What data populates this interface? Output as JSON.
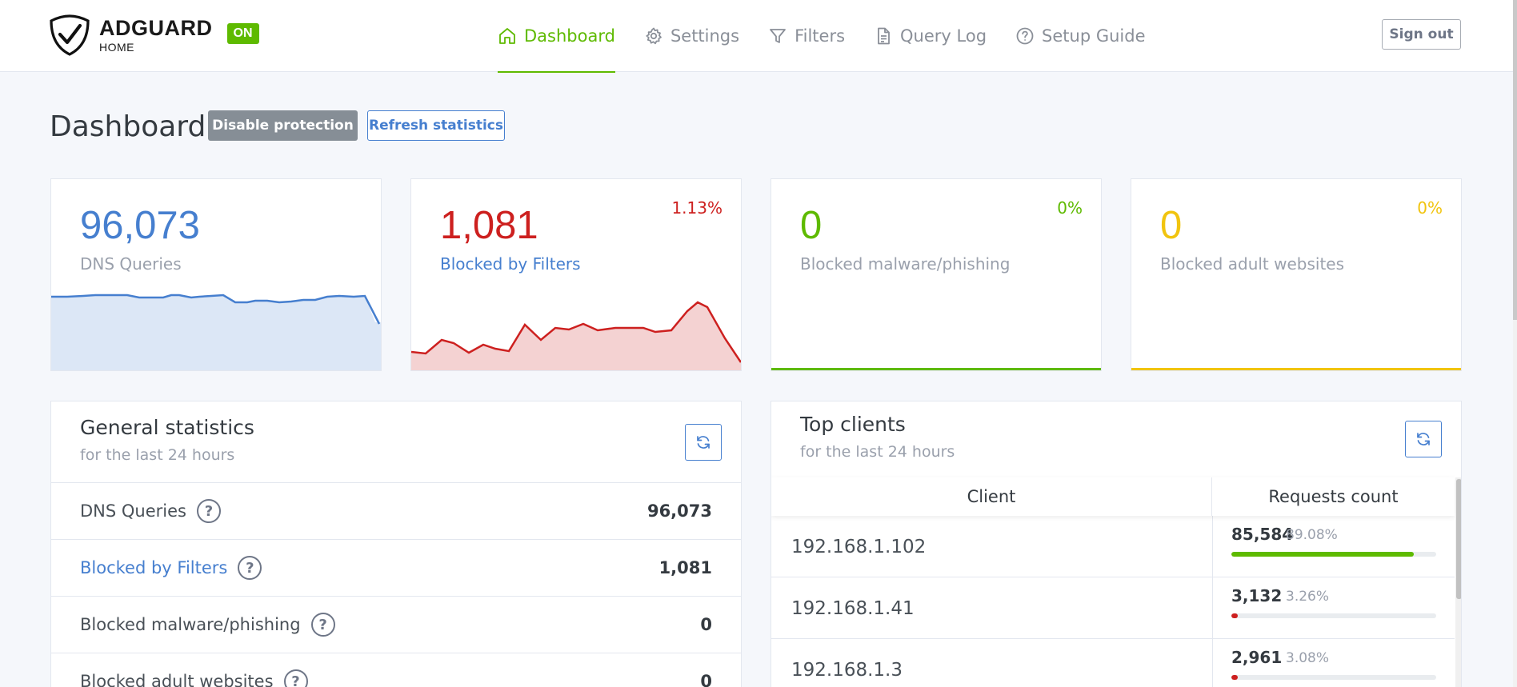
{
  "header": {
    "brand_name": "ADGUARD",
    "brand_sub": "HOME",
    "status_badge": "ON",
    "nav": [
      {
        "label": "Dashboard",
        "icon": "home-icon",
        "active": true
      },
      {
        "label": "Settings",
        "icon": "gear-icon",
        "active": false
      },
      {
        "label": "Filters",
        "icon": "filter-icon",
        "active": false
      },
      {
        "label": "Query Log",
        "icon": "document-icon",
        "active": false
      },
      {
        "label": "Setup Guide",
        "icon": "help-circle-icon",
        "active": false
      }
    ],
    "sign_out": "Sign out"
  },
  "page": {
    "title": "Dashboard",
    "disable_protection": "Disable protection",
    "refresh_statistics": "Refresh statistics"
  },
  "cards": [
    {
      "value": "96,073",
      "label": "DNS Queries",
      "percent": "",
      "color": "#467fcf"
    },
    {
      "value": "1,081",
      "label": "Blocked by Filters",
      "percent": "1.13%",
      "color": "#cd201f"
    },
    {
      "value": "0",
      "label": "Blocked malware/phishing",
      "percent": "0%",
      "color": "#5eba00"
    },
    {
      "value": "0",
      "label": "Blocked adult websites",
      "percent": "0%",
      "color": "#f1c40f"
    }
  ],
  "general_statistics": {
    "title": "General statistics",
    "subtitle": "for the last 24 hours",
    "rows": [
      {
        "label": "DNS Queries",
        "value": "96,073"
      },
      {
        "label": "Blocked by Filters",
        "value": "1,081"
      },
      {
        "label": "Blocked malware/phishing",
        "value": "0"
      },
      {
        "label": "Blocked adult websites",
        "value": "0"
      }
    ]
  },
  "top_clients": {
    "title": "Top clients",
    "subtitle": "for the last 24 hours",
    "columns": [
      "Client",
      "Requests count"
    ],
    "rows": [
      {
        "ip": "192.168.1.102",
        "count": "85,584",
        "percent": "89.08%",
        "fraction": 0.8908,
        "color": "#5eba00"
      },
      {
        "ip": "192.168.1.41",
        "count": "3,132",
        "percent": "3.26%",
        "fraction": 0.0326,
        "color": "#cd201f"
      },
      {
        "ip": "192.168.1.3",
        "count": "2,961",
        "percent": "3.08%",
        "fraction": 0.0308,
        "color": "#cd201f"
      }
    ]
  },
  "colors": {
    "accent_green": "#5eba00",
    "accent_blue": "#467fcf",
    "accent_red": "#cd201f",
    "accent_yellow": "#f1c40f"
  }
}
